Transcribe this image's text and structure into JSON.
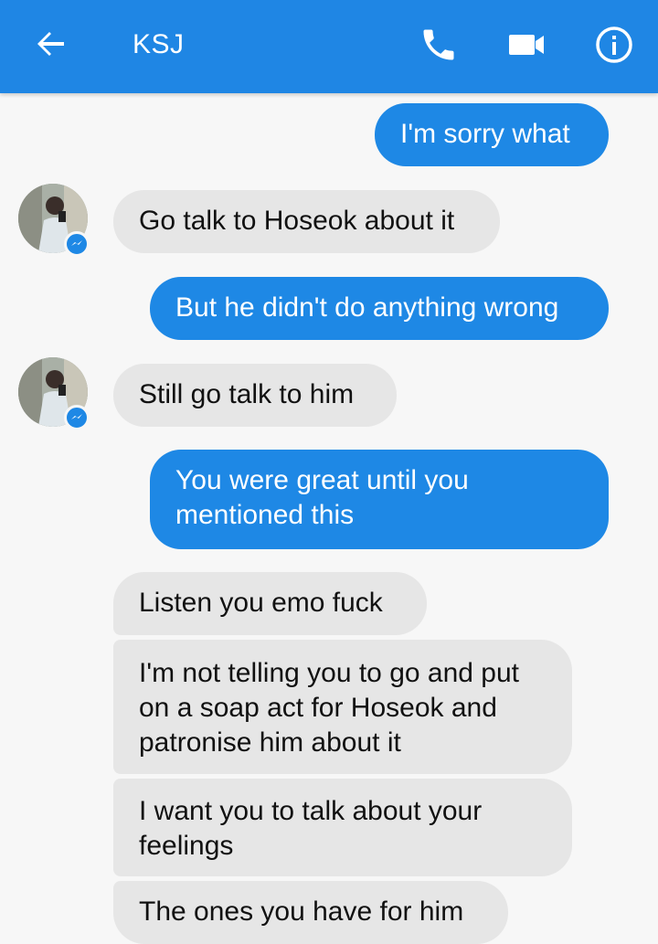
{
  "header": {
    "contact_name": "KSJ",
    "bar_color": "#1f86e4",
    "icons": [
      "back-arrow-icon",
      "phone-icon",
      "video-camera-icon",
      "info-icon"
    ]
  },
  "messages": [
    {
      "direction": "sent",
      "text": "I'm sorry what"
    },
    {
      "direction": "received",
      "text": "Go talk to Hoseok about it"
    },
    {
      "direction": "sent",
      "text": "But he didn't do anything wrong"
    },
    {
      "direction": "received",
      "text": "Still go talk to him"
    },
    {
      "direction": "sent",
      "lines": [
        "You were great until you",
        "mentioned this"
      ]
    },
    {
      "direction": "received",
      "text": "Listen you emo fuck"
    },
    {
      "direction": "received",
      "lines": [
        "I'm not telling you to go and put",
        "on a soap act for Hoseok and",
        "patronise him about it"
      ]
    },
    {
      "direction": "received",
      "lines": [
        "I want you to talk about your",
        "feelings"
      ]
    },
    {
      "direction": "received",
      "text": "The ones you have for him"
    }
  ],
  "colors": {
    "sent_bubble": "#1e88e5",
    "received_bubble": "#e6e6e6",
    "background": "#f7f7f7"
  }
}
